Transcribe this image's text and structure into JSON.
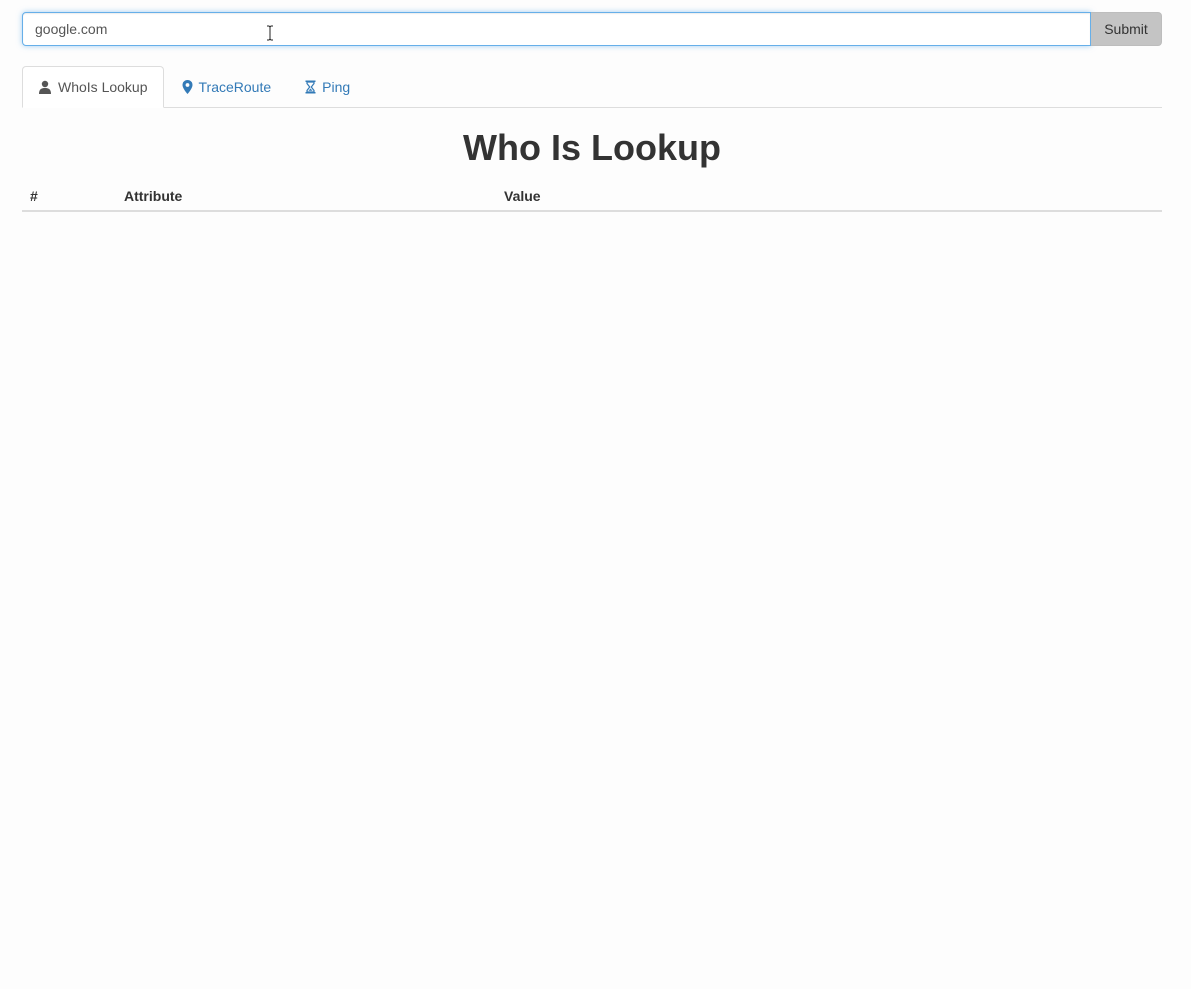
{
  "search": {
    "value": "google.com",
    "submit_label": "Submit"
  },
  "tabs": [
    {
      "label": "WhoIs Lookup",
      "icon": "user-icon",
      "active": true
    },
    {
      "label": "TraceRoute",
      "icon": "map-marker-icon",
      "active": false
    },
    {
      "label": "Ping",
      "icon": "hourglass-icon",
      "active": false
    }
  ],
  "main": {
    "title": "Who Is Lookup",
    "table": {
      "columns": [
        "#",
        "Attribute",
        "Value"
      ],
      "rows": []
    }
  },
  "colors": {
    "link": "#337ab7",
    "active_tab_text": "#555555",
    "input_focus_border": "#66afe9",
    "submit_bg": "#c4c4c4"
  }
}
